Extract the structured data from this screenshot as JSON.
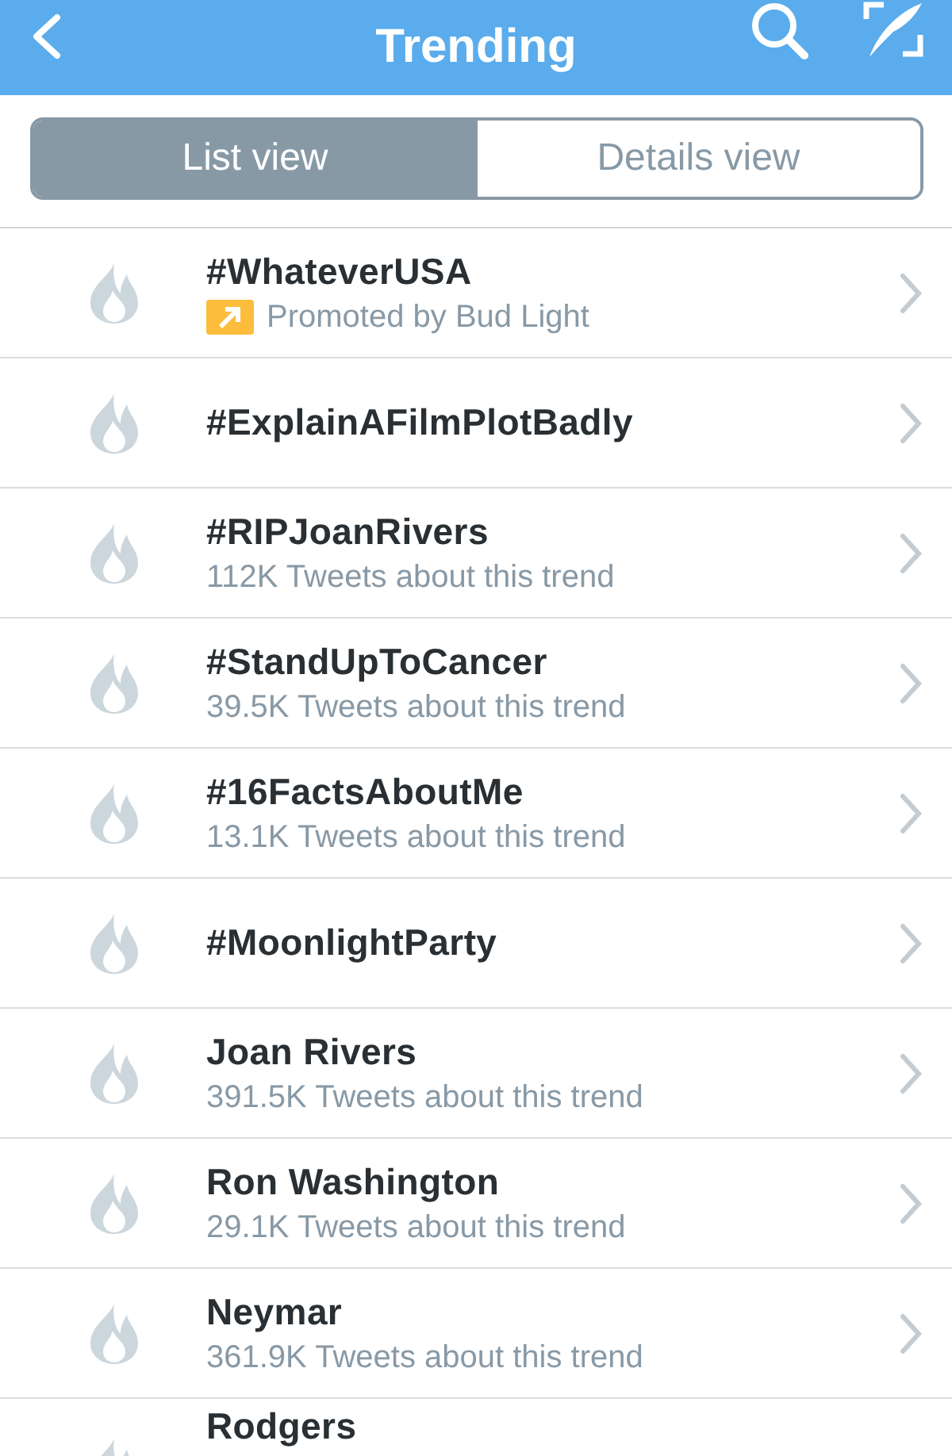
{
  "header": {
    "title": "Trending"
  },
  "view_tabs": [
    {
      "label": "List view",
      "selected": true
    },
    {
      "label": "Details view",
      "selected": false
    }
  ],
  "trends": [
    {
      "kind": "promoted",
      "name": "#WhateverUSA",
      "subtitle": "Promoted by Bud Light"
    },
    {
      "kind": "plain",
      "name": "#ExplainAFilmPlotBadly"
    },
    {
      "kind": "count",
      "name": "#RIPJoanRivers",
      "subtitle": "112K Tweets about this trend"
    },
    {
      "kind": "count",
      "name": "#StandUpToCancer",
      "subtitle": "39.5K Tweets about this trend"
    },
    {
      "kind": "count",
      "name": "#16FactsAboutMe",
      "subtitle": "13.1K Tweets about this trend"
    },
    {
      "kind": "plain",
      "name": "#MoonlightParty"
    },
    {
      "kind": "count",
      "name": "Joan Rivers",
      "subtitle": "391.5K Tweets about this trend"
    },
    {
      "kind": "count",
      "name": "Ron Washington",
      "subtitle": "29.1K Tweets about this trend"
    },
    {
      "kind": "count",
      "name": "Neymar",
      "subtitle": "361.9K Tweets about this trend"
    },
    {
      "kind": "partial",
      "name": "Rodgers"
    }
  ]
}
